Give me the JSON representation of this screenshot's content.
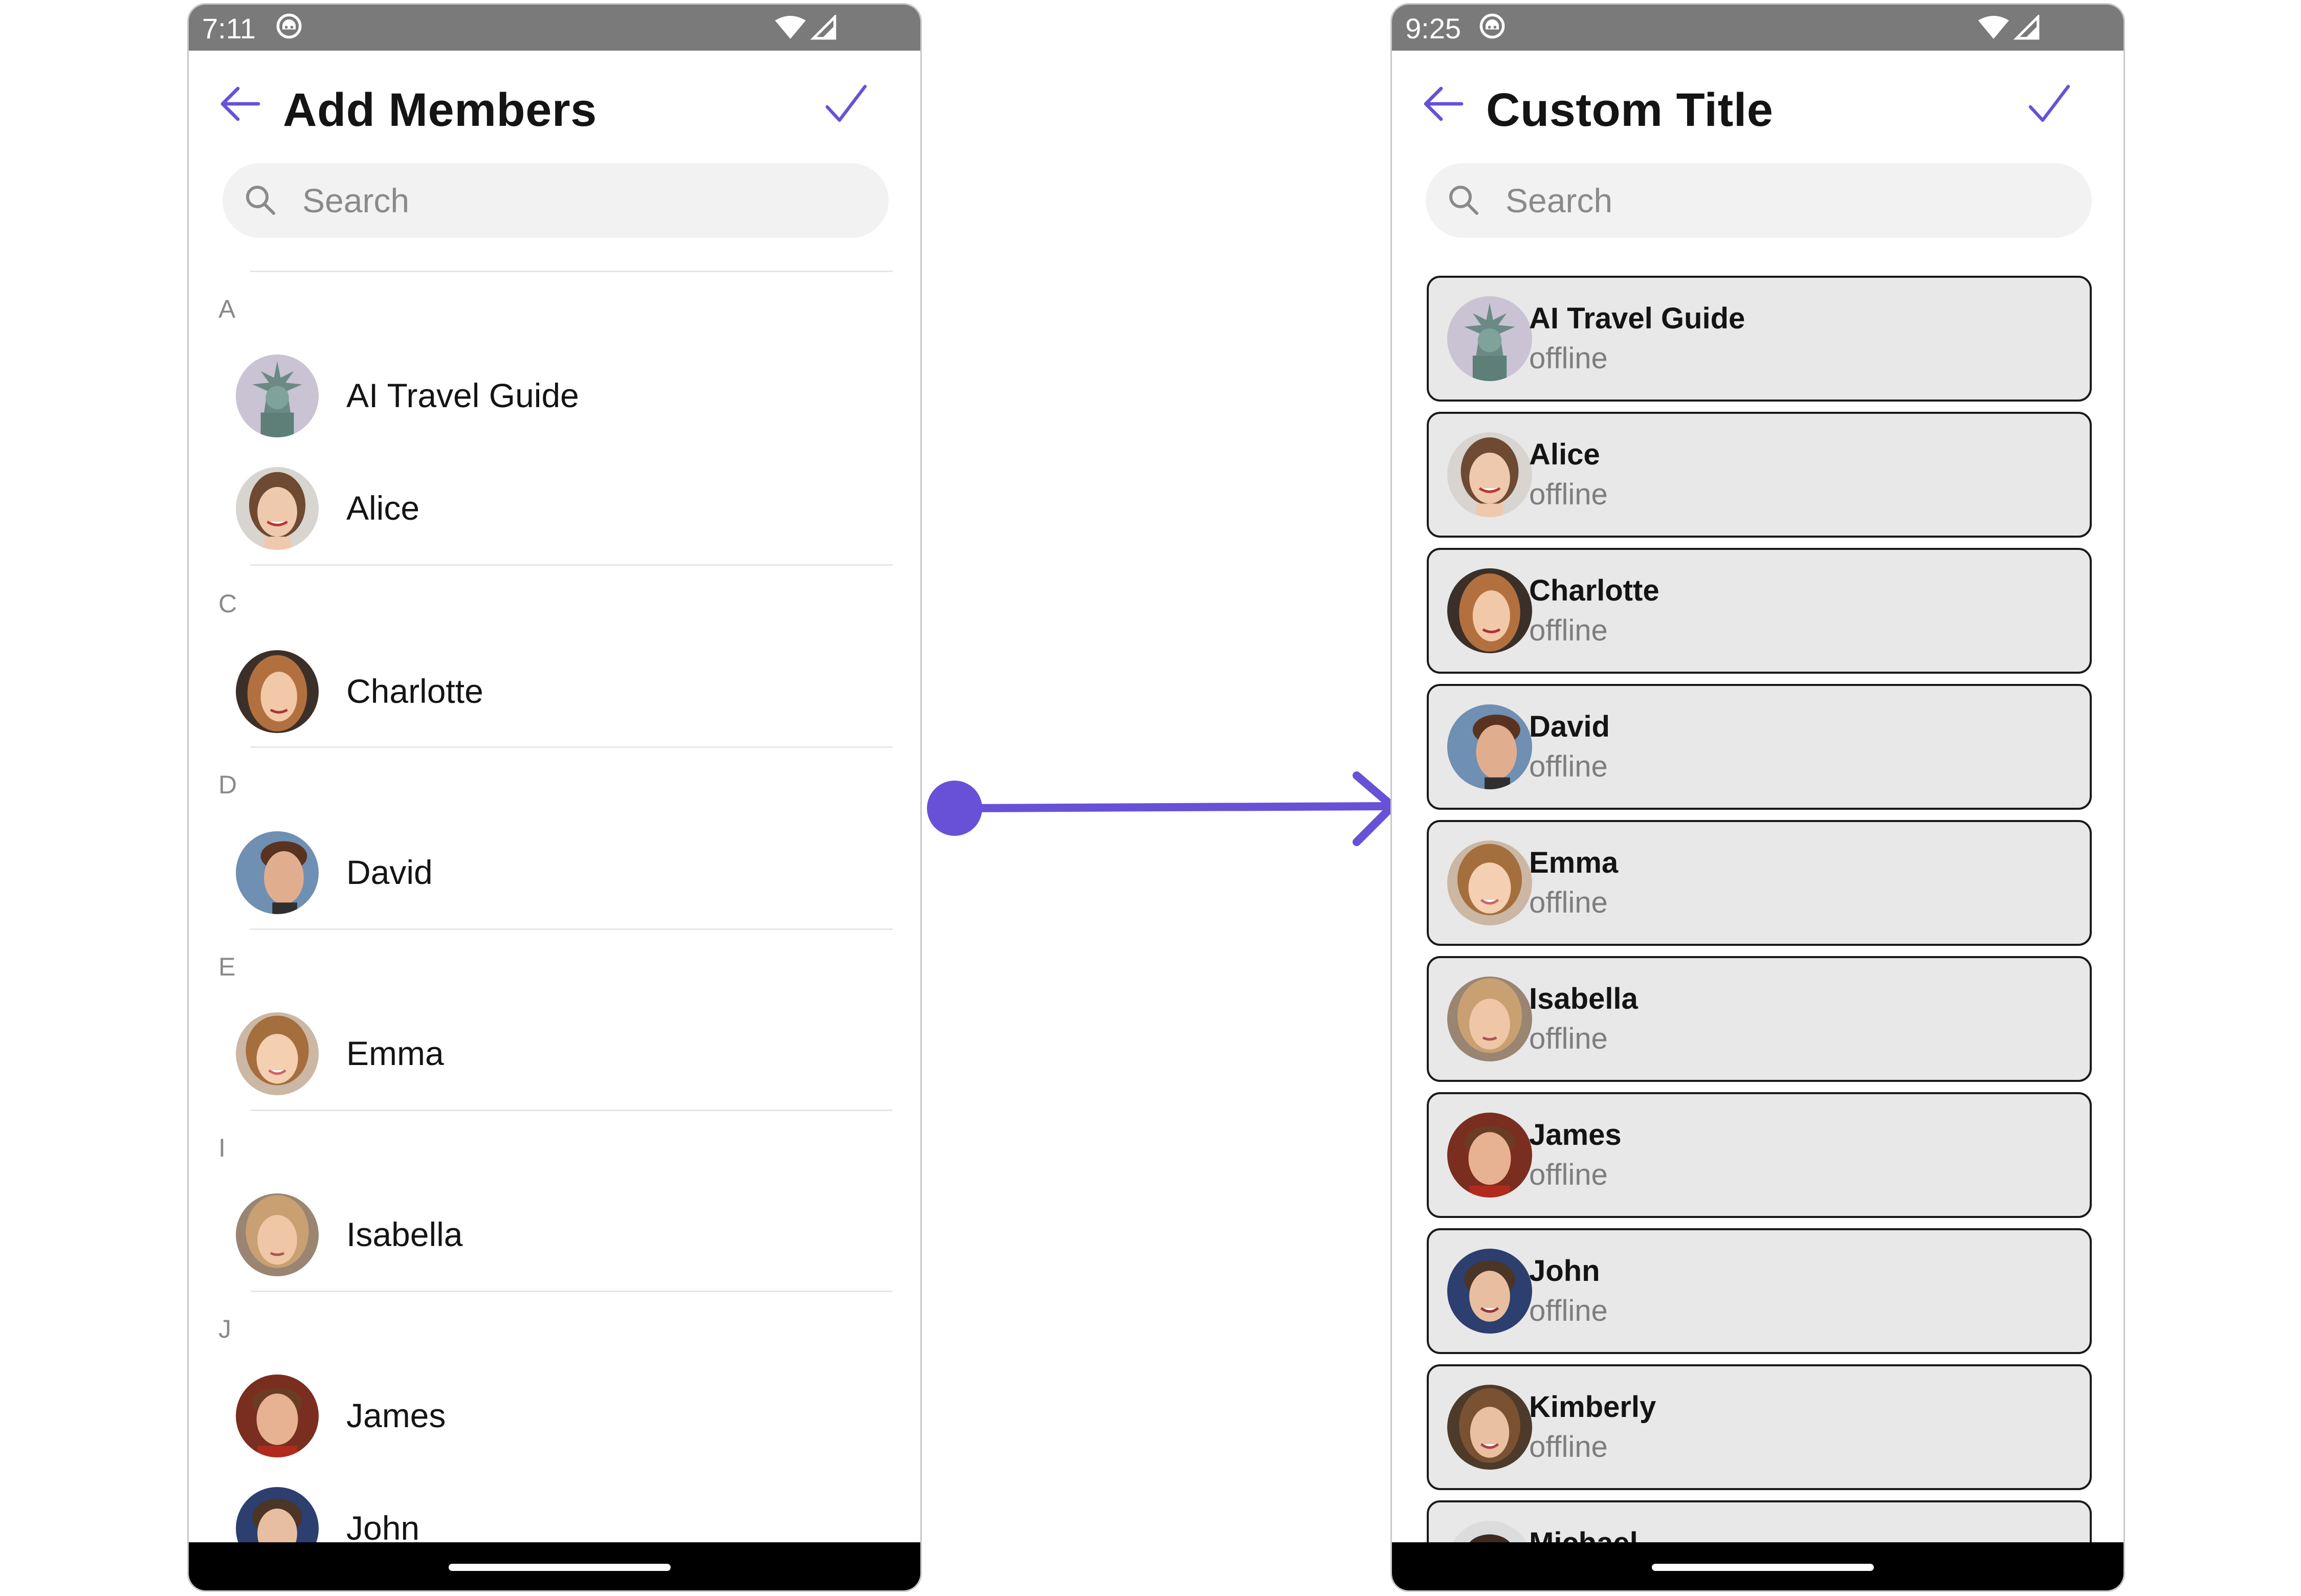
{
  "accent_color": "#6851D6",
  "left_screen": {
    "status_time": "7:11",
    "title": "Add Members",
    "search_placeholder": "Search",
    "sections": [
      {
        "letter": "A",
        "members": [
          "AI Travel Guide",
          "Alice"
        ]
      },
      {
        "letter": "C",
        "members": [
          "Charlotte"
        ]
      },
      {
        "letter": "D",
        "members": [
          "David"
        ]
      },
      {
        "letter": "E",
        "members": [
          "Emma"
        ]
      },
      {
        "letter": "I",
        "members": [
          "Isabella"
        ]
      },
      {
        "letter": "J",
        "members": [
          "James",
          "John"
        ]
      }
    ]
  },
  "right_screen": {
    "status_time": "9:25",
    "title": "Custom Title",
    "search_placeholder": "Search",
    "members": [
      {
        "name": "AI Travel Guide",
        "status": "offline"
      },
      {
        "name": "Alice",
        "status": "offline"
      },
      {
        "name": "Charlotte",
        "status": "offline"
      },
      {
        "name": "David",
        "status": "offline"
      },
      {
        "name": "Emma",
        "status": "offline"
      },
      {
        "name": "Isabella",
        "status": "offline"
      },
      {
        "name": "James",
        "status": "offline"
      },
      {
        "name": "John",
        "status": "offline"
      },
      {
        "name": "Kimberly",
        "status": "offline"
      },
      {
        "name": "Michael",
        "status": ""
      }
    ]
  },
  "icons": {
    "back": "arrow-left-icon",
    "confirm": "check-icon",
    "search": "search-icon",
    "notification": "notification-icon",
    "wifi": "wifi-icon",
    "signal": "cell-signal-icon"
  }
}
